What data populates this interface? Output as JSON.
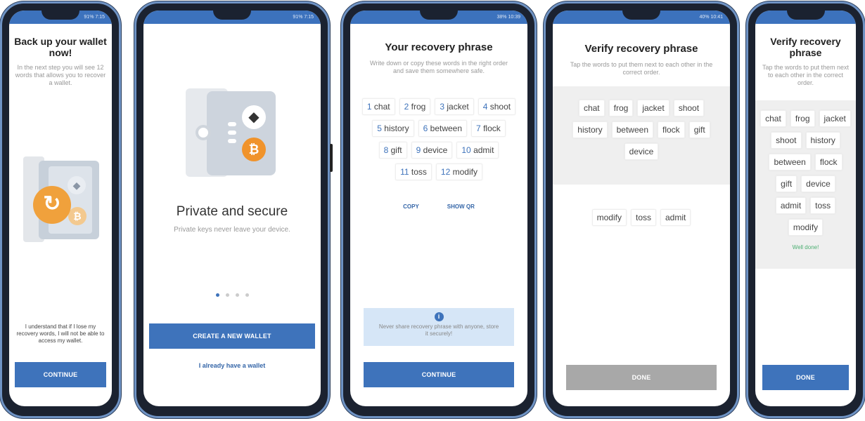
{
  "phones": [
    {
      "status": {
        "left": "",
        "right": "91% 7:15"
      },
      "title": "Back up your wallet now!",
      "subtitle": "In the next step you will see 12 words that allows you to recover a wallet.",
      "confirm": "I understand that if I lose my recovery words, I will not be able to access my wallet.",
      "button": "CONTINUE"
    },
    {
      "status": {
        "left": "",
        "right": "91% 7:15"
      },
      "title": "Private and secure",
      "subtitle": "Private keys never leave your device.",
      "button": "CREATE A NEW WALLET",
      "link": "I already have a wallet"
    },
    {
      "status": {
        "left": "",
        "right": "38% 10:39"
      },
      "title": "Your recovery phrase",
      "subtitle": "Write down or copy these words in the right order and save them somewhere safe.",
      "words": [
        {
          "n": "1",
          "w": "chat"
        },
        {
          "n": "2",
          "w": "frog"
        },
        {
          "n": "3",
          "w": "jacket"
        },
        {
          "n": "4",
          "w": "shoot"
        },
        {
          "n": "5",
          "w": "history"
        },
        {
          "n": "6",
          "w": "between"
        },
        {
          "n": "7",
          "w": "flock"
        },
        {
          "n": "8",
          "w": "gift"
        },
        {
          "n": "9",
          "w": "device"
        },
        {
          "n": "10",
          "w": "admit"
        },
        {
          "n": "11",
          "w": "toss"
        },
        {
          "n": "12",
          "w": "modify"
        }
      ],
      "copy": "COPY",
      "show_qr": "SHOW QR",
      "info": "Never share recovery phrase with anyone, store it securely!",
      "button": "CONTINUE"
    },
    {
      "status": {
        "left": "",
        "right": "40% 10:41"
      },
      "title": "Verify recovery phrase",
      "subtitle": "Tap the words to put them next to each other in the correct order.",
      "selected": [
        "chat",
        "frog",
        "jacket",
        "shoot",
        "history",
        "between",
        "flock",
        "gift",
        "device"
      ],
      "remaining": [
        "modify",
        "toss",
        "admit"
      ],
      "button": "DONE"
    },
    {
      "title": "Verify recovery phrase",
      "subtitle": "Tap the words to put them next to each other in the correct order.",
      "selected": [
        "chat",
        "frog",
        "jacket",
        "shoot",
        "history",
        "between",
        "flock",
        "gift",
        "device",
        "admit",
        "toss",
        "modify"
      ],
      "success": "Well done!",
      "button": "DONE"
    }
  ],
  "colors": {
    "accent": "#3e73bb",
    "success": "#4caf72",
    "disabled": "#a8a8a8",
    "info_bg": "#d6e6f7"
  }
}
